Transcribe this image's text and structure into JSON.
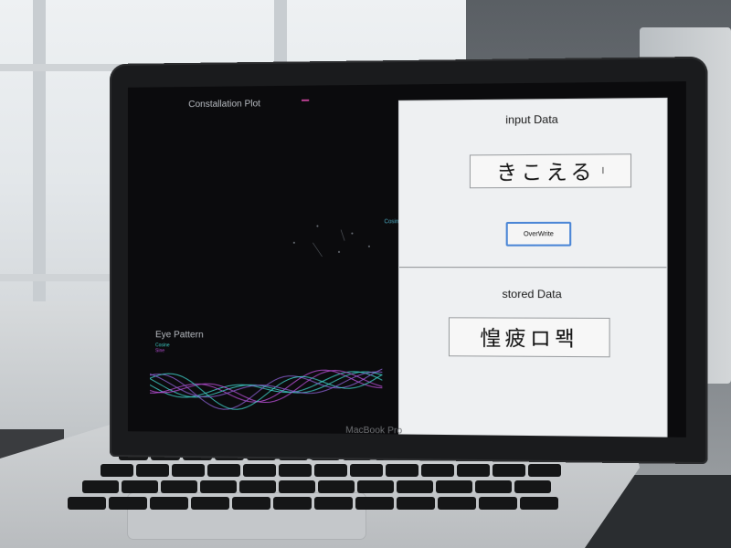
{
  "laptop": {
    "brand_label": "MacBook Pro"
  },
  "visualizer": {
    "constellation_title": "Constallation Plot",
    "cosine_label": "Cosine",
    "eye_title": "Eye Pattern",
    "eye_legend": [
      "Cosine",
      "Sine"
    ],
    "colors": {
      "cyan": "#3fd0c9",
      "magenta": "#b84fd6",
      "purple": "#8a5fd0"
    }
  },
  "input_panel": {
    "label": "input Data",
    "value": "きこえる",
    "button_label": "OverWrite"
  },
  "stored_panel": {
    "label": "stored Data",
    "value": "惶疲ロ뫡"
  }
}
